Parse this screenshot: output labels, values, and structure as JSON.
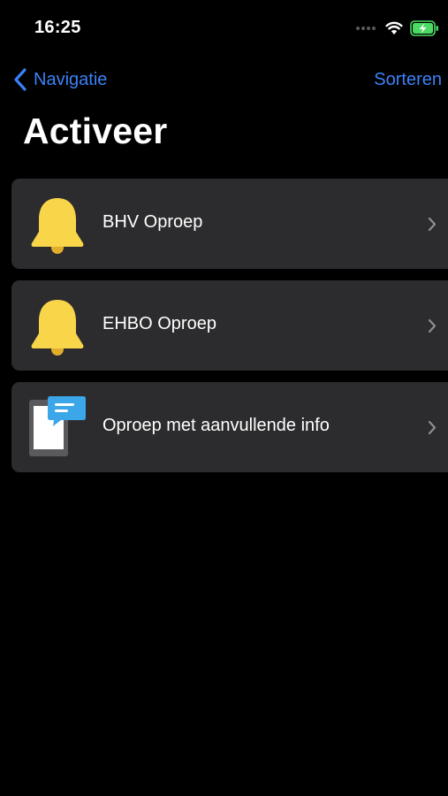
{
  "status_bar": {
    "time": "16:25"
  },
  "nav": {
    "back_label": "Navigatie",
    "sort_label": "Sorteren"
  },
  "page": {
    "title": "Activeer"
  },
  "items": [
    {
      "label": "BHV Oproep",
      "icon": "bell-icon"
    },
    {
      "label": "EHBO Oproep",
      "icon": "bell-icon"
    },
    {
      "label": "Oproep met aanvullende info",
      "icon": "message-phone-icon"
    }
  ],
  "colors": {
    "background": "#000000",
    "card": "#2c2c2e",
    "accent": "#3a82f7",
    "bell": "#f9d54a",
    "message": "#3ba6e8",
    "battery": "#4cd964"
  }
}
